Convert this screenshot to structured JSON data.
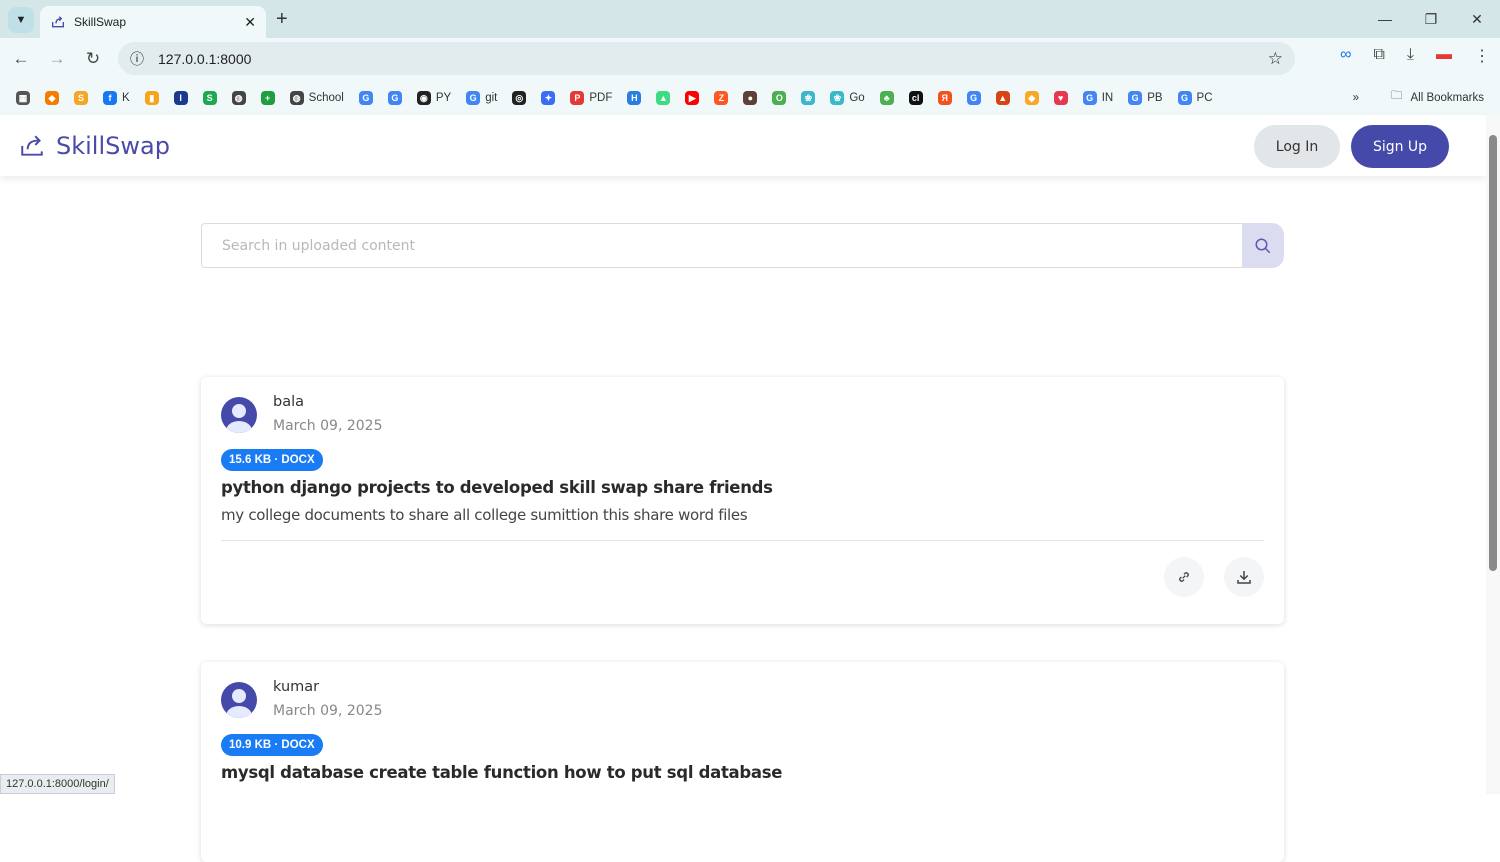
{
  "browser": {
    "tab_title": "SkillSwap",
    "url": "127.0.0.1:8000",
    "status_url": "127.0.0.1:8000/login/",
    "all_bookmarks": "All Bookmarks",
    "bookmarks": [
      {
        "label": "",
        "color": "#555",
        "glyph": "▦"
      },
      {
        "label": "",
        "color": "#f57c00",
        "glyph": "◆"
      },
      {
        "label": "",
        "color": "#f5a623",
        "glyph": "S"
      },
      {
        "label": "K",
        "color": "#1877f2",
        "glyph": "f"
      },
      {
        "label": "",
        "color": "#f7a41d",
        "glyph": "▮"
      },
      {
        "label": "",
        "color": "#1a3a8f",
        "glyph": "I"
      },
      {
        "label": "",
        "color": "#1fa84f",
        "glyph": "S"
      },
      {
        "label": "",
        "color": "#444",
        "glyph": "◍"
      },
      {
        "label": "",
        "color": "#1e9e3e",
        "glyph": "+"
      },
      {
        "label": "School",
        "color": "#444",
        "glyph": "◍"
      },
      {
        "label": "",
        "color": "#4285f4",
        "glyph": "G"
      },
      {
        "label": "",
        "color": "#4285f4",
        "glyph": "G"
      },
      {
        "label": "PY",
        "color": "#222",
        "glyph": "◉"
      },
      {
        "label": "git",
        "color": "#4285f4",
        "glyph": "G"
      },
      {
        "label": "",
        "color": "#222",
        "glyph": "◎"
      },
      {
        "label": "",
        "color": "#3b6cf6",
        "glyph": "✦"
      },
      {
        "label": "PDF",
        "color": "#e53935",
        "glyph": "P"
      },
      {
        "label": "",
        "color": "#2a7de1",
        "glyph": "H"
      },
      {
        "label": "",
        "color": "#3ddc84",
        "glyph": "▲"
      },
      {
        "label": "",
        "color": "#ff0000",
        "glyph": "▶"
      },
      {
        "label": "",
        "color": "#ff5722",
        "glyph": "Z"
      },
      {
        "label": "",
        "color": "#5d4037",
        "glyph": "●"
      },
      {
        "label": "",
        "color": "#4caf50",
        "glyph": "O"
      },
      {
        "label": "",
        "color": "#3ab8c9",
        "glyph": "❀"
      },
      {
        "label": "Go",
        "color": "#3ab8c9",
        "glyph": "❀"
      },
      {
        "label": "",
        "color": "#4caf50",
        "glyph": "♣"
      },
      {
        "label": "",
        "color": "#111",
        "glyph": "cl"
      },
      {
        "label": "",
        "color": "#f4511e",
        "glyph": "Я"
      },
      {
        "label": "",
        "color": "#4285f4",
        "glyph": "G"
      },
      {
        "label": "",
        "color": "#d84315",
        "glyph": "▲"
      },
      {
        "label": "",
        "color": "#f9a825",
        "glyph": "◆"
      },
      {
        "label": "",
        "color": "#e53950",
        "glyph": "♥"
      },
      {
        "label": "IN",
        "color": "#4285f4",
        "glyph": "G"
      },
      {
        "label": "PB",
        "color": "#4285f4",
        "glyph": "G"
      },
      {
        "label": "PC",
        "color": "#4285f4",
        "glyph": "G"
      }
    ]
  },
  "app": {
    "brand": "SkillSwap",
    "login": "Log In",
    "signup": "Sign Up",
    "search_placeholder": "Search in uploaded content",
    "accent": "#4549a9",
    "posts": [
      {
        "user": "bala",
        "date": "March 09, 2025",
        "badge": "15.6 KB · DOCX",
        "title": "python django projects to developed skill swap share friends",
        "description": "my college documents to share all college sumittion this share word files"
      },
      {
        "user": "kumar",
        "date": "March 09, 2025",
        "badge": "10.9 KB · DOCX",
        "title": "mysql database create table function how to put sql database"
      }
    ]
  }
}
